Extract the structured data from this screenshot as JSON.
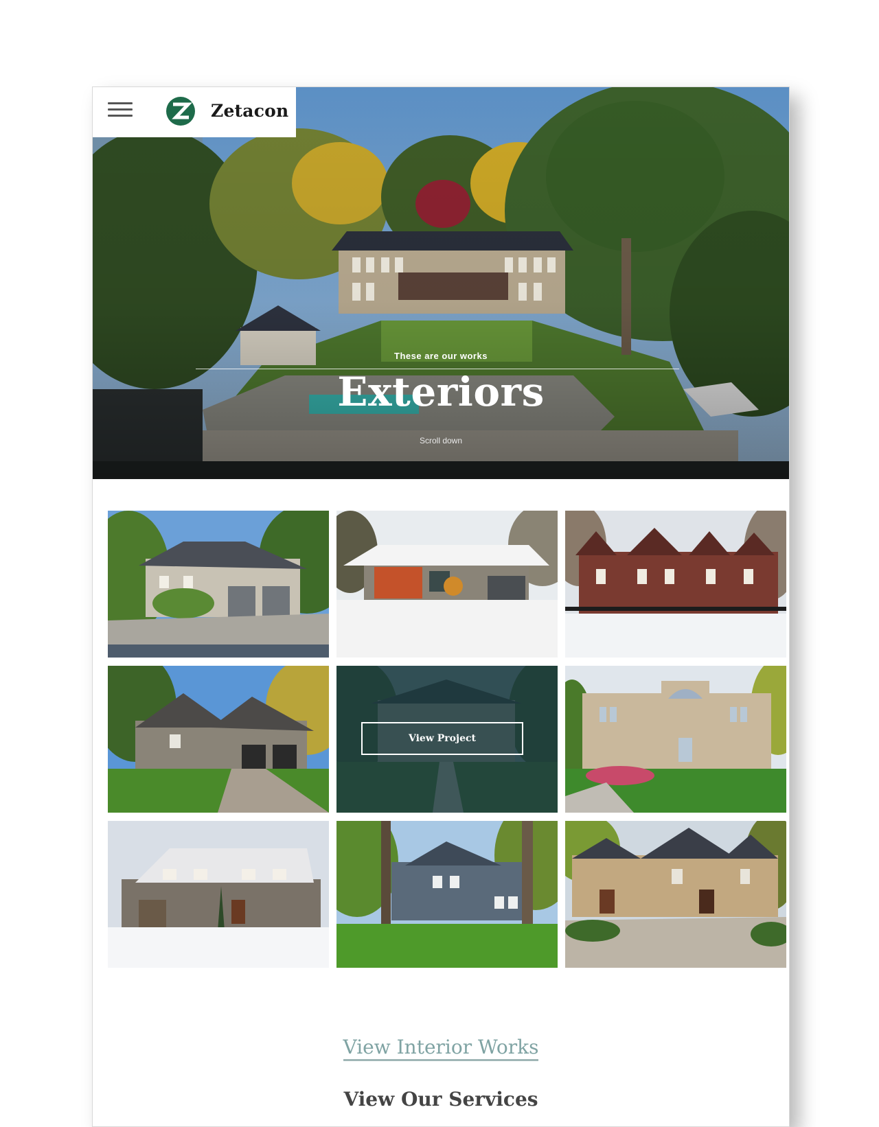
{
  "brand": {
    "name": "Zetacon",
    "accent_color": "#1e6b4a"
  },
  "navbar": {
    "menu_icon": "hamburger-menu-icon"
  },
  "hero": {
    "kicker": "These are our works",
    "title": "Exteriors",
    "scroll_hint": "Scroll down"
  },
  "grid": {
    "tiles": [
      {
        "scene": "two-storey house with double garage, summer trees"
      },
      {
        "scene": "modern bungalow with orange facade in snow"
      },
      {
        "scene": "red brick gothic house with snow"
      },
      {
        "scene": "stone house with gables and autumn trees"
      },
      {
        "scene": "grey stone house, hovered",
        "overlay_label": "View Project"
      },
      {
        "scene": "stone manor with arched window"
      },
      {
        "scene": "stone cottage with snow"
      },
      {
        "scene": "grey house among tall trees"
      },
      {
        "scene": "stone chateau with turrets"
      }
    ]
  },
  "links": {
    "interior": "View Interior Works",
    "services": "View Our Services"
  }
}
